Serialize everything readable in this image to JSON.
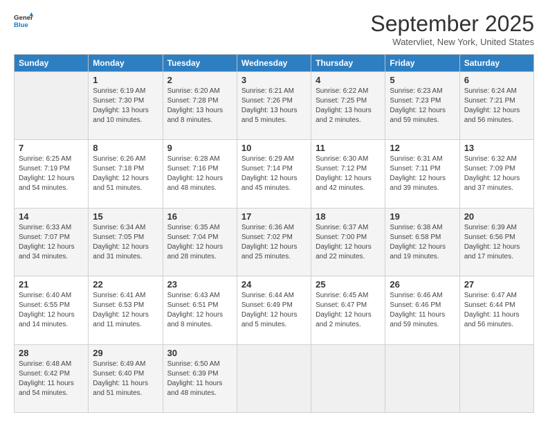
{
  "logo": {
    "line1": "General",
    "line2": "Blue"
  },
  "title": "September 2025",
  "location": "Watervliet, New York, United States",
  "weekdays": [
    "Sunday",
    "Monday",
    "Tuesday",
    "Wednesday",
    "Thursday",
    "Friday",
    "Saturday"
  ],
  "weeks": [
    [
      {
        "day": "",
        "info": ""
      },
      {
        "day": "1",
        "info": "Sunrise: 6:19 AM\nSunset: 7:30 PM\nDaylight: 13 hours\nand 10 minutes."
      },
      {
        "day": "2",
        "info": "Sunrise: 6:20 AM\nSunset: 7:28 PM\nDaylight: 13 hours\nand 8 minutes."
      },
      {
        "day": "3",
        "info": "Sunrise: 6:21 AM\nSunset: 7:26 PM\nDaylight: 13 hours\nand 5 minutes."
      },
      {
        "day": "4",
        "info": "Sunrise: 6:22 AM\nSunset: 7:25 PM\nDaylight: 13 hours\nand 2 minutes."
      },
      {
        "day": "5",
        "info": "Sunrise: 6:23 AM\nSunset: 7:23 PM\nDaylight: 12 hours\nand 59 minutes."
      },
      {
        "day": "6",
        "info": "Sunrise: 6:24 AM\nSunset: 7:21 PM\nDaylight: 12 hours\nand 56 minutes."
      }
    ],
    [
      {
        "day": "7",
        "info": "Sunrise: 6:25 AM\nSunset: 7:19 PM\nDaylight: 12 hours\nand 54 minutes."
      },
      {
        "day": "8",
        "info": "Sunrise: 6:26 AM\nSunset: 7:18 PM\nDaylight: 12 hours\nand 51 minutes."
      },
      {
        "day": "9",
        "info": "Sunrise: 6:28 AM\nSunset: 7:16 PM\nDaylight: 12 hours\nand 48 minutes."
      },
      {
        "day": "10",
        "info": "Sunrise: 6:29 AM\nSunset: 7:14 PM\nDaylight: 12 hours\nand 45 minutes."
      },
      {
        "day": "11",
        "info": "Sunrise: 6:30 AM\nSunset: 7:12 PM\nDaylight: 12 hours\nand 42 minutes."
      },
      {
        "day": "12",
        "info": "Sunrise: 6:31 AM\nSunset: 7:11 PM\nDaylight: 12 hours\nand 39 minutes."
      },
      {
        "day": "13",
        "info": "Sunrise: 6:32 AM\nSunset: 7:09 PM\nDaylight: 12 hours\nand 37 minutes."
      }
    ],
    [
      {
        "day": "14",
        "info": "Sunrise: 6:33 AM\nSunset: 7:07 PM\nDaylight: 12 hours\nand 34 minutes."
      },
      {
        "day": "15",
        "info": "Sunrise: 6:34 AM\nSunset: 7:05 PM\nDaylight: 12 hours\nand 31 minutes."
      },
      {
        "day": "16",
        "info": "Sunrise: 6:35 AM\nSunset: 7:04 PM\nDaylight: 12 hours\nand 28 minutes."
      },
      {
        "day": "17",
        "info": "Sunrise: 6:36 AM\nSunset: 7:02 PM\nDaylight: 12 hours\nand 25 minutes."
      },
      {
        "day": "18",
        "info": "Sunrise: 6:37 AM\nSunset: 7:00 PM\nDaylight: 12 hours\nand 22 minutes."
      },
      {
        "day": "19",
        "info": "Sunrise: 6:38 AM\nSunset: 6:58 PM\nDaylight: 12 hours\nand 19 minutes."
      },
      {
        "day": "20",
        "info": "Sunrise: 6:39 AM\nSunset: 6:56 PM\nDaylight: 12 hours\nand 17 minutes."
      }
    ],
    [
      {
        "day": "21",
        "info": "Sunrise: 6:40 AM\nSunset: 6:55 PM\nDaylight: 12 hours\nand 14 minutes."
      },
      {
        "day": "22",
        "info": "Sunrise: 6:41 AM\nSunset: 6:53 PM\nDaylight: 12 hours\nand 11 minutes."
      },
      {
        "day": "23",
        "info": "Sunrise: 6:43 AM\nSunset: 6:51 PM\nDaylight: 12 hours\nand 8 minutes."
      },
      {
        "day": "24",
        "info": "Sunrise: 6:44 AM\nSunset: 6:49 PM\nDaylight: 12 hours\nand 5 minutes."
      },
      {
        "day": "25",
        "info": "Sunrise: 6:45 AM\nSunset: 6:47 PM\nDaylight: 12 hours\nand 2 minutes."
      },
      {
        "day": "26",
        "info": "Sunrise: 6:46 AM\nSunset: 6:46 PM\nDaylight: 11 hours\nand 59 minutes."
      },
      {
        "day": "27",
        "info": "Sunrise: 6:47 AM\nSunset: 6:44 PM\nDaylight: 11 hours\nand 56 minutes."
      }
    ],
    [
      {
        "day": "28",
        "info": "Sunrise: 6:48 AM\nSunset: 6:42 PM\nDaylight: 11 hours\nand 54 minutes."
      },
      {
        "day": "29",
        "info": "Sunrise: 6:49 AM\nSunset: 6:40 PM\nDaylight: 11 hours\nand 51 minutes."
      },
      {
        "day": "30",
        "info": "Sunrise: 6:50 AM\nSunset: 6:39 PM\nDaylight: 11 hours\nand 48 minutes."
      },
      {
        "day": "",
        "info": ""
      },
      {
        "day": "",
        "info": ""
      },
      {
        "day": "",
        "info": ""
      },
      {
        "day": "",
        "info": ""
      }
    ]
  ]
}
